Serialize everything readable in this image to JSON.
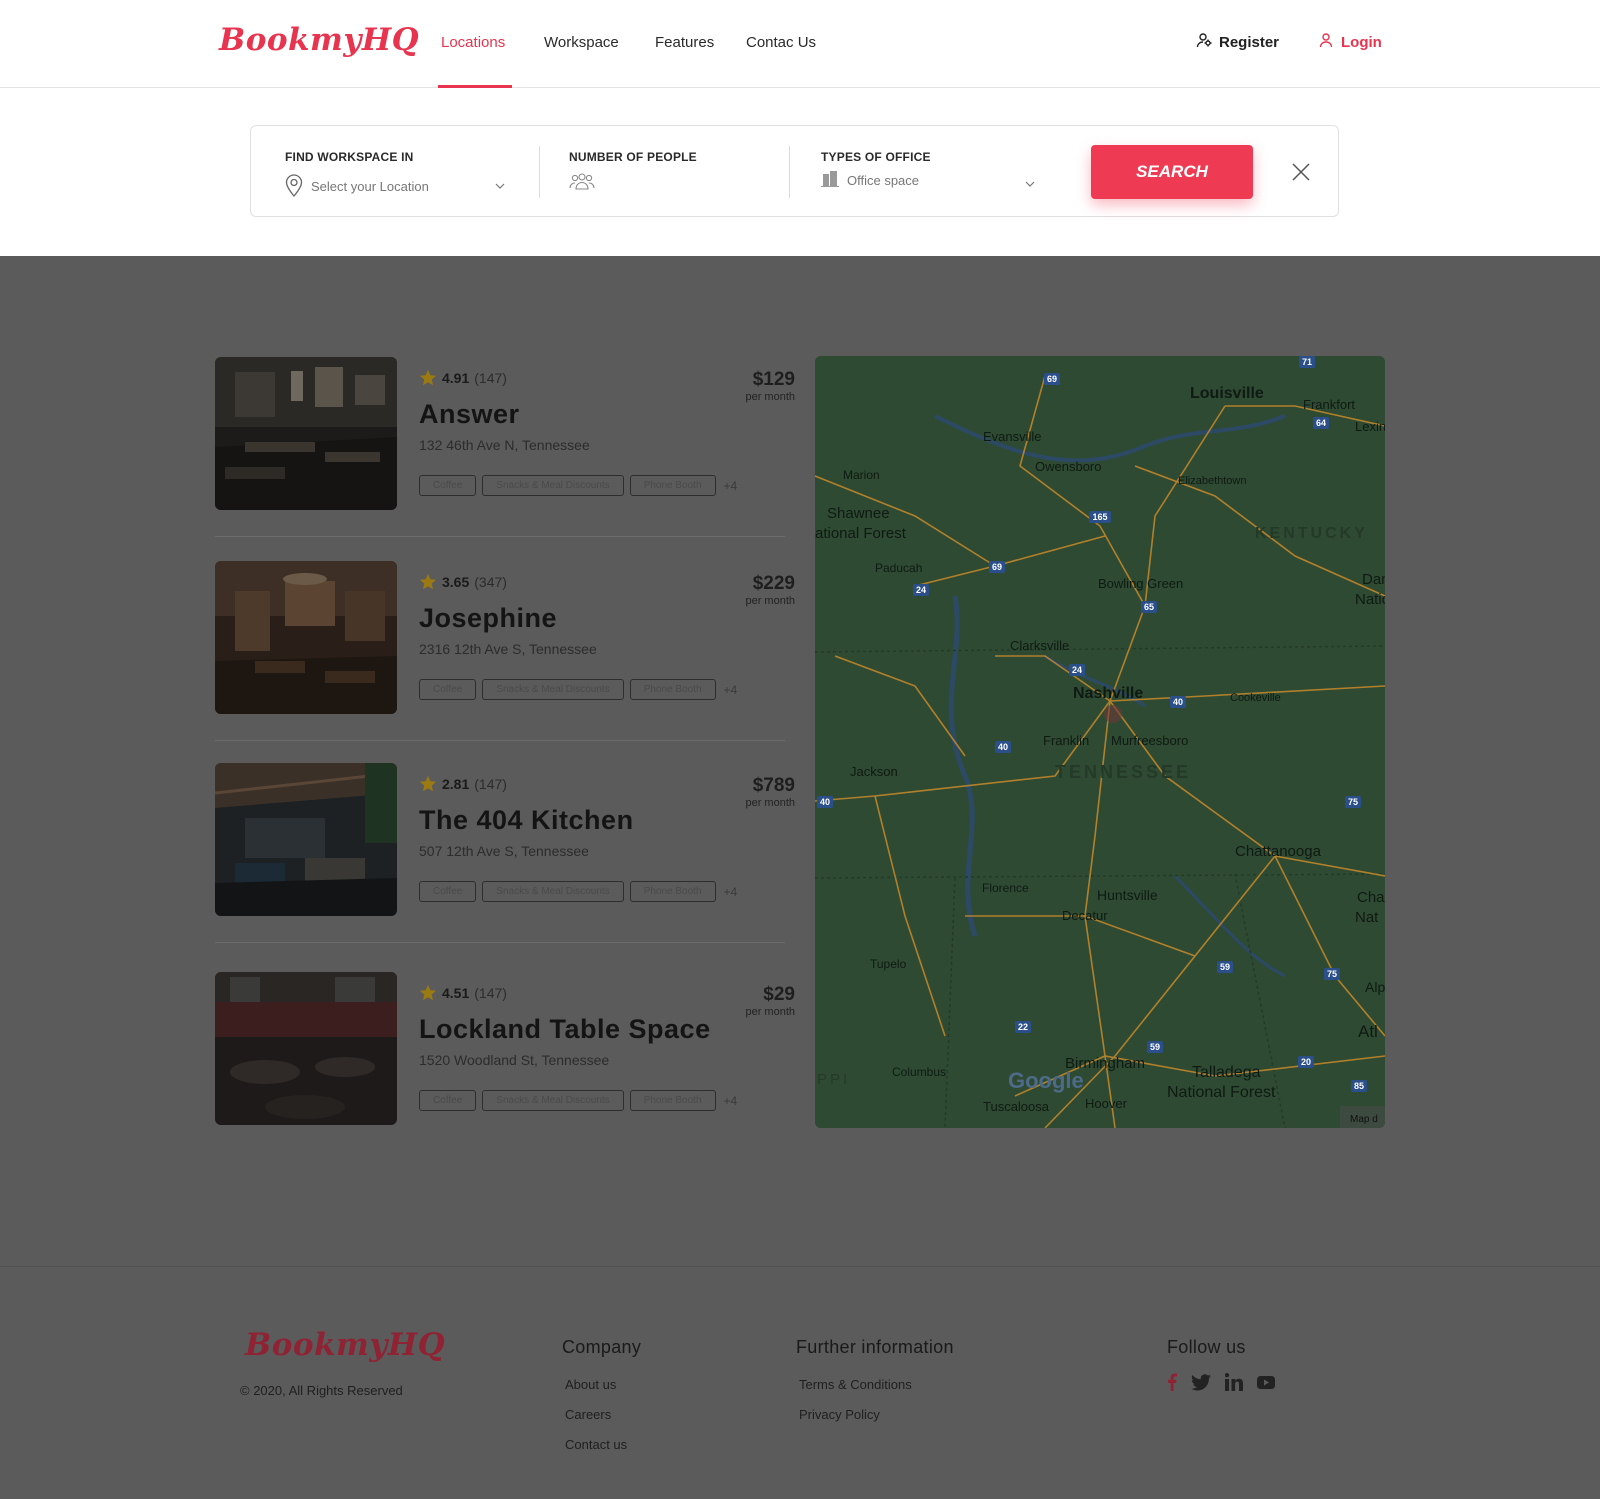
{
  "header": {
    "logo": "BookmyHQ",
    "nav": [
      "Locations",
      "Workspace",
      "Features",
      "Contac Us"
    ],
    "active_nav": "Locations",
    "register": "Register",
    "login": "Login"
  },
  "search": {
    "location_label": "FIND WORKSPACE IN",
    "location_placeholder": "Select your Location",
    "people_label": "NUMBER OF PEOPLE",
    "office_label": "TYPES OF OFFICE",
    "office_value": "Office space",
    "button": "SEARCH"
  },
  "listings": [
    {
      "rating": "4.91",
      "reviews": "(147)",
      "name": "Answer",
      "address": "132 46th Ave N, Tennessee",
      "price": "$129",
      "per": "per month",
      "tags": [
        "Coffee",
        "Snacks & Meal Discounts",
        "Phone Booth"
      ],
      "more": "+4"
    },
    {
      "rating": "3.65",
      "reviews": "(347)",
      "name": "Josephine",
      "address": "2316 12th Ave S, Tennessee",
      "price": "$229",
      "per": "per month",
      "tags": [
        "Coffee",
        "Snacks & Meal Discounts",
        "Phone Booth"
      ],
      "more": "+4"
    },
    {
      "rating": "2.81",
      "reviews": "(147)",
      "name": "The 404 Kitchen",
      "address": "507 12th Ave S, Tennessee",
      "price": "$789",
      "per": "per month",
      "tags": [
        "Coffee",
        "Snacks & Meal Discounts",
        "Phone Booth"
      ],
      "more": "+4"
    },
    {
      "rating": "4.51",
      "reviews": "(147)",
      "name": "Lockland Table  Space",
      "address": "1520 Woodland St, Tennessee",
      "price": "$29",
      "per": "per month",
      "tags": [
        "Coffee",
        "Snacks & Meal Discounts",
        "Phone Booth"
      ],
      "more": "+4"
    }
  ],
  "map": {
    "labels": {
      "louisville": "Louisville",
      "frankfort": "Frankfort",
      "lexington": "Lexing",
      "evansville": "Evansville",
      "owensboro": "Owensboro",
      "marion": "Marion",
      "elizabethtown": "Elizabethtown",
      "shawnee": "Shawnee",
      "national_forest": "ational Forest",
      "kentucky": "KENTUCKY",
      "paducah": "Paducah",
      "bowling_green": "Bowling Green",
      "dani": "Dani",
      "natio": "Natio",
      "clarksville": "Clarksville",
      "nashville": "Nashville",
      "cookeville": "Cookeville",
      "franklin": "Franklin",
      "murfreesboro": "Murfreesboro",
      "jackson": "Jackson",
      "tennessee": "TENNESSEE",
      "chattanooga": "Chattanooga",
      "florence": "Florence",
      "huntsville": "Huntsville",
      "decatur": "Decatur",
      "cha": "Cha",
      "nat": "Nat",
      "tupelo": "Tupelo",
      "alp": "Alp",
      "atl": "Atl",
      "birmingham": "Birmingham",
      "talladega": "Talladega",
      "talladega_nf": "National Forest",
      "columbus": "Columbus",
      "ppi": "PPI",
      "tuscaloosa": "Tuscaloosa",
      "hoover": "Hoover",
      "google": "Google",
      "map_credit": "Map d"
    },
    "highways": [
      "69",
      "71",
      "64",
      "165",
      "69",
      "24",
      "65",
      "24",
      "40",
      "40",
      "40",
      "75",
      "59",
      "75",
      "22",
      "59",
      "20",
      "85"
    ]
  },
  "footer": {
    "logo": "BookmyHQ",
    "copyright": "© 2020, All Rights Reserved",
    "company_heading": "Company",
    "company_links": [
      "About us",
      "Careers",
      "Contact us"
    ],
    "further_heading": "Further information",
    "further_links": [
      "Terms & Conditions",
      "Privacy Policy"
    ],
    "follow_heading": "Follow us",
    "social": [
      "facebook-icon",
      "twitter-icon",
      "linkedin-icon",
      "youtube-icon"
    ]
  },
  "colors": {
    "accent": "#e8344e",
    "overlay": "#5b5b5b",
    "map_base": "#2e4a33",
    "road": "#c98a2a"
  }
}
